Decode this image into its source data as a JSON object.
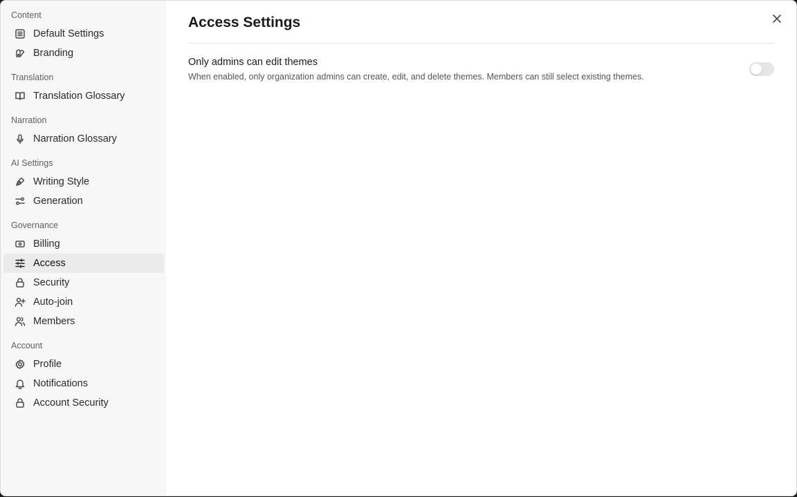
{
  "sidebar": {
    "sections": [
      {
        "title": "Content",
        "items": [
          {
            "label": "Default Settings",
            "icon": "document-list-icon"
          },
          {
            "label": "Branding",
            "icon": "palette-icon"
          }
        ]
      },
      {
        "title": "Translation",
        "items": [
          {
            "label": "Translation Glossary",
            "icon": "book-open-icon"
          }
        ]
      },
      {
        "title": "Narration",
        "items": [
          {
            "label": "Narration Glossary",
            "icon": "microphone-icon"
          }
        ]
      },
      {
        "title": "AI Settings",
        "items": [
          {
            "label": "Writing Style",
            "icon": "pen-tool-icon"
          },
          {
            "label": "Generation",
            "icon": "settings-sliders-icon"
          }
        ]
      },
      {
        "title": "Governance",
        "items": [
          {
            "label": "Billing",
            "icon": "banknote-icon"
          },
          {
            "label": "Access",
            "icon": "sliders-horizontal-icon",
            "active": true
          },
          {
            "label": "Security",
            "icon": "lock-icon"
          },
          {
            "label": "Auto-join",
            "icon": "user-plus-icon"
          },
          {
            "label": "Members",
            "icon": "users-icon"
          }
        ]
      },
      {
        "title": "Account",
        "items": [
          {
            "label": "Profile",
            "icon": "gear-icon"
          },
          {
            "label": "Notifications",
            "icon": "bell-icon"
          },
          {
            "label": "Account Security",
            "icon": "lock-icon"
          }
        ]
      }
    ]
  },
  "main": {
    "title": "Access Settings",
    "settings": [
      {
        "label": "Only admins can edit themes",
        "description": "When enabled, only organization admins can create, edit, and delete themes. Members can still select existing themes.",
        "enabled": false
      }
    ]
  }
}
